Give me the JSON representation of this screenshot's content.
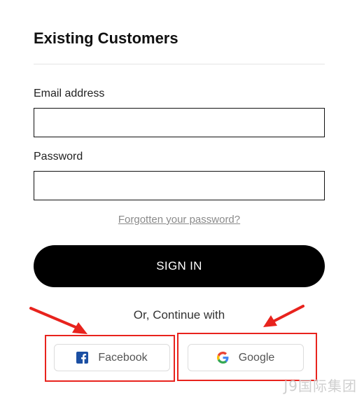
{
  "form": {
    "title": "Existing Customers",
    "email_label": "Email address",
    "email_value": "",
    "password_label": "Password",
    "password_value": "",
    "forgot_link": "Forgotten your password?",
    "signin_label": "SIGN IN",
    "or_text": "Or, Continue with"
  },
  "social": {
    "facebook_label": "Facebook",
    "google_label": "Google"
  },
  "annotation": {
    "highlight_color": "#e8231d"
  },
  "watermark": "J9国际集团",
  "colors": {
    "primary_button": "#000000",
    "facebook_blue": "#1877f2"
  }
}
